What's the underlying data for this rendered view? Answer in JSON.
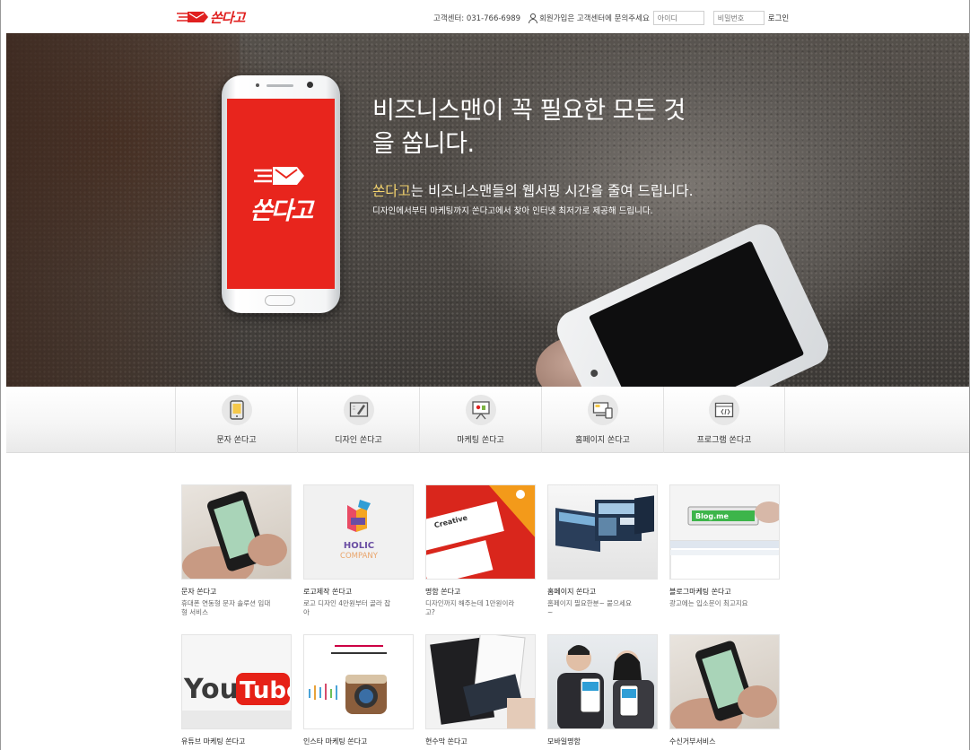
{
  "header": {
    "logo_text": "쏜다고",
    "customer_center": "고객센터: 031-766-6989",
    "member_notice": "회원가입은 고객센터에 문의주세요",
    "id_placeholder": "아이디",
    "pw_placeholder": "비밀번호",
    "login_label": "로그인"
  },
  "hero": {
    "phone_screen_text": "쏜다고",
    "title_line1": "비즈니스맨이 꼭 필요한 모든 것",
    "title_line2": "을 쏩니다.",
    "sub1_highlight": "쏜다고",
    "sub1_rest": "는 비즈니스맨들의 웹서핑 시간을 줄여 드립니다.",
    "sub2": "디자인에서부터 마케팅까지 쏜다고에서 찾아 인터넷 최저가로 제공해 드립니다."
  },
  "categories": [
    {
      "label": "문자 쏜다고",
      "icon": "mobile-sms-icon"
    },
    {
      "label": "디자인 쏜다고",
      "icon": "design-pen-icon"
    },
    {
      "label": "마케팅 쏜다고",
      "icon": "presentation-board-icon"
    },
    {
      "label": "홈페이지 쏜다고",
      "icon": "devices-icon"
    },
    {
      "label": "프로그램 쏜다고",
      "icon": "code-window-icon"
    }
  ],
  "products_row1": [
    {
      "title": "문자 쏜다고",
      "desc": "휴대폰 연동형 문자 솔루션 임대형 서비스",
      "image": "phone-in-hand"
    },
    {
      "title": "로고제작 쏜다고",
      "desc": "로고 디자인 4만원부터 골라 잡아",
      "image": "holic-company-logo",
      "image_text": [
        "HOLIC",
        "COMPANY"
      ]
    },
    {
      "title": "명함 쏜다고",
      "desc": "디자인까지 해주는데 1만원이라고?",
      "image": "creative-business-card",
      "image_text": [
        "Creative"
      ]
    },
    {
      "title": "홈페이지 쏜다고",
      "desc": "홈페이지 필요한분~ 붙으세요~",
      "image": "website-screens"
    },
    {
      "title": "블로그마케팅 쏜다고",
      "desc": "광고에는 입소문이 최고지요",
      "image": "blog-me-key",
      "image_text": [
        "Blog.me"
      ]
    }
  ],
  "products_row2": [
    {
      "title": "유튜브 마케팅 쏜다고",
      "image": "youtube-logo",
      "image_text": [
        "You",
        "Tube"
      ]
    },
    {
      "title": "인스타 마케팅 쏜다고",
      "image": "instagram-camera"
    },
    {
      "title": "현수막 쏜다고",
      "image": "dark-stationery"
    },
    {
      "title": "모바일명함",
      "image": "people-with-phones"
    },
    {
      "title": "수신거부서비스",
      "image": "phone-in-hand"
    }
  ],
  "colors": {
    "brand_red": "#e0201f",
    "highlight_yellow": "#f3d36d"
  }
}
